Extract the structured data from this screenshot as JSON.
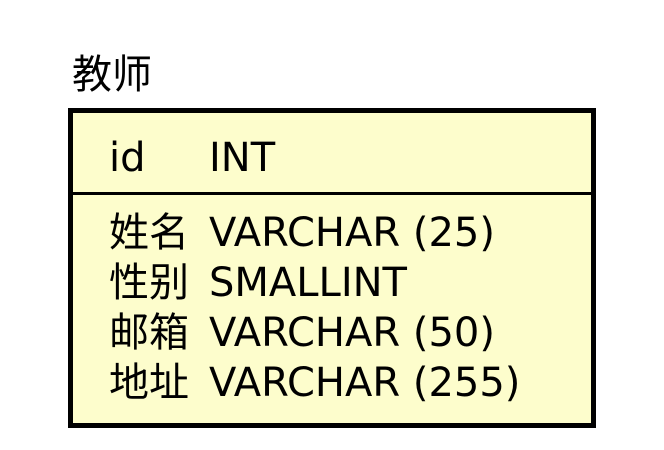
{
  "colors": {
    "entity_fill": "#fdfdcc",
    "border": "#000000",
    "text": "#000000"
  },
  "entity": {
    "title": "教师",
    "primary_key": {
      "name": "id",
      "type": "INT"
    },
    "attributes": [
      {
        "name": "姓名",
        "type": "VARCHAR (25)"
      },
      {
        "name": "性别",
        "type": "SMALLINT"
      },
      {
        "name": "邮箱",
        "type": "VARCHAR (50)"
      },
      {
        "name": "地址",
        "type": "VARCHAR (255)"
      }
    ]
  }
}
